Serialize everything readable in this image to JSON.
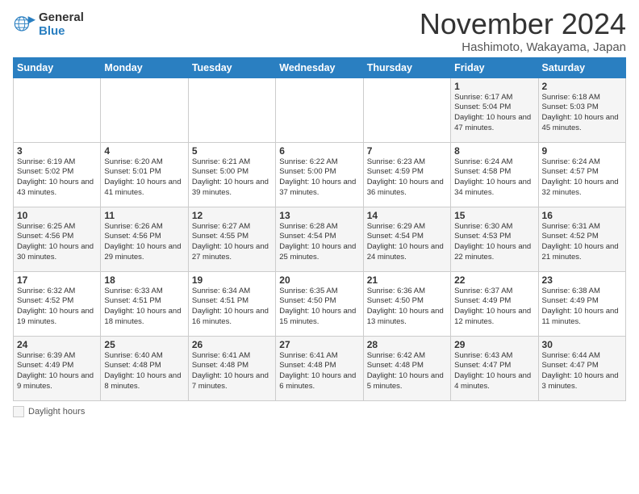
{
  "logo": {
    "general": "General",
    "blue": "Blue"
  },
  "title": "November 2024",
  "location": "Hashimoto, Wakayama, Japan",
  "days": [
    "Sunday",
    "Monday",
    "Tuesday",
    "Wednesday",
    "Thursday",
    "Friday",
    "Saturday"
  ],
  "footer": {
    "label": "Daylight hours"
  },
  "weeks": [
    [
      {
        "date": "",
        "info": ""
      },
      {
        "date": "",
        "info": ""
      },
      {
        "date": "",
        "info": ""
      },
      {
        "date": "",
        "info": ""
      },
      {
        "date": "",
        "info": ""
      },
      {
        "date": "1",
        "info": "Sunrise: 6:17 AM\nSunset: 5:04 PM\nDaylight: 10 hours and 47 minutes."
      },
      {
        "date": "2",
        "info": "Sunrise: 6:18 AM\nSunset: 5:03 PM\nDaylight: 10 hours and 45 minutes."
      }
    ],
    [
      {
        "date": "3",
        "info": "Sunrise: 6:19 AM\nSunset: 5:02 PM\nDaylight: 10 hours and 43 minutes."
      },
      {
        "date": "4",
        "info": "Sunrise: 6:20 AM\nSunset: 5:01 PM\nDaylight: 10 hours and 41 minutes."
      },
      {
        "date": "5",
        "info": "Sunrise: 6:21 AM\nSunset: 5:00 PM\nDaylight: 10 hours and 39 minutes."
      },
      {
        "date": "6",
        "info": "Sunrise: 6:22 AM\nSunset: 5:00 PM\nDaylight: 10 hours and 37 minutes."
      },
      {
        "date": "7",
        "info": "Sunrise: 6:23 AM\nSunset: 4:59 PM\nDaylight: 10 hours and 36 minutes."
      },
      {
        "date": "8",
        "info": "Sunrise: 6:24 AM\nSunset: 4:58 PM\nDaylight: 10 hours and 34 minutes."
      },
      {
        "date": "9",
        "info": "Sunrise: 6:24 AM\nSunset: 4:57 PM\nDaylight: 10 hours and 32 minutes."
      }
    ],
    [
      {
        "date": "10",
        "info": "Sunrise: 6:25 AM\nSunset: 4:56 PM\nDaylight: 10 hours and 30 minutes."
      },
      {
        "date": "11",
        "info": "Sunrise: 6:26 AM\nSunset: 4:56 PM\nDaylight: 10 hours and 29 minutes."
      },
      {
        "date": "12",
        "info": "Sunrise: 6:27 AM\nSunset: 4:55 PM\nDaylight: 10 hours and 27 minutes."
      },
      {
        "date": "13",
        "info": "Sunrise: 6:28 AM\nSunset: 4:54 PM\nDaylight: 10 hours and 25 minutes."
      },
      {
        "date": "14",
        "info": "Sunrise: 6:29 AM\nSunset: 4:54 PM\nDaylight: 10 hours and 24 minutes."
      },
      {
        "date": "15",
        "info": "Sunrise: 6:30 AM\nSunset: 4:53 PM\nDaylight: 10 hours and 22 minutes."
      },
      {
        "date": "16",
        "info": "Sunrise: 6:31 AM\nSunset: 4:52 PM\nDaylight: 10 hours and 21 minutes."
      }
    ],
    [
      {
        "date": "17",
        "info": "Sunrise: 6:32 AM\nSunset: 4:52 PM\nDaylight: 10 hours and 19 minutes."
      },
      {
        "date": "18",
        "info": "Sunrise: 6:33 AM\nSunset: 4:51 PM\nDaylight: 10 hours and 18 minutes."
      },
      {
        "date": "19",
        "info": "Sunrise: 6:34 AM\nSunset: 4:51 PM\nDaylight: 10 hours and 16 minutes."
      },
      {
        "date": "20",
        "info": "Sunrise: 6:35 AM\nSunset: 4:50 PM\nDaylight: 10 hours and 15 minutes."
      },
      {
        "date": "21",
        "info": "Sunrise: 6:36 AM\nSunset: 4:50 PM\nDaylight: 10 hours and 13 minutes."
      },
      {
        "date": "22",
        "info": "Sunrise: 6:37 AM\nSunset: 4:49 PM\nDaylight: 10 hours and 12 minutes."
      },
      {
        "date": "23",
        "info": "Sunrise: 6:38 AM\nSunset: 4:49 PM\nDaylight: 10 hours and 11 minutes."
      }
    ],
    [
      {
        "date": "24",
        "info": "Sunrise: 6:39 AM\nSunset: 4:49 PM\nDaylight: 10 hours and 9 minutes."
      },
      {
        "date": "25",
        "info": "Sunrise: 6:40 AM\nSunset: 4:48 PM\nDaylight: 10 hours and 8 minutes."
      },
      {
        "date": "26",
        "info": "Sunrise: 6:41 AM\nSunset: 4:48 PM\nDaylight: 10 hours and 7 minutes."
      },
      {
        "date": "27",
        "info": "Sunrise: 6:41 AM\nSunset: 4:48 PM\nDaylight: 10 hours and 6 minutes."
      },
      {
        "date": "28",
        "info": "Sunrise: 6:42 AM\nSunset: 4:48 PM\nDaylight: 10 hours and 5 minutes."
      },
      {
        "date": "29",
        "info": "Sunrise: 6:43 AM\nSunset: 4:47 PM\nDaylight: 10 hours and 4 minutes."
      },
      {
        "date": "30",
        "info": "Sunrise: 6:44 AM\nSunset: 4:47 PM\nDaylight: 10 hours and 3 minutes."
      }
    ]
  ]
}
